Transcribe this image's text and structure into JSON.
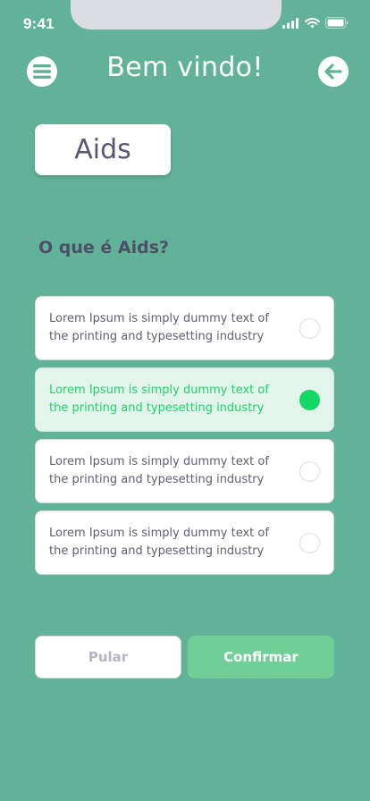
{
  "status_bar": {
    "time": "9:41"
  },
  "header": {
    "title": "Bem vindo!"
  },
  "topic": {
    "label": "Aids"
  },
  "quiz": {
    "question": "O que é Aids?",
    "options": [
      {
        "text": "Lorem Ipsum is simply dummy text of the printing and typesetting industry",
        "selected": false
      },
      {
        "text": "Lorem Ipsum is simply dummy text of the printing and typesetting industry",
        "selected": true
      },
      {
        "text": "Lorem Ipsum is simply dummy text of the printing and typesetting industry",
        "selected": false
      },
      {
        "text": "Lorem Ipsum is simply dummy text of the printing and typesetting industry",
        "selected": false
      }
    ]
  },
  "actions": {
    "skip_label": "Pular",
    "confirm_label": "Confirmar"
  },
  "colors": {
    "background": "#62b29a",
    "selected_accent": "#13d865",
    "confirm_button": "#6fcf97"
  },
  "icons": {
    "menu": "hamburger-menu-icon",
    "back": "arrow-left-icon",
    "signal": "cellular-signal-icon",
    "wifi": "wifi-icon",
    "battery": "battery-icon"
  }
}
